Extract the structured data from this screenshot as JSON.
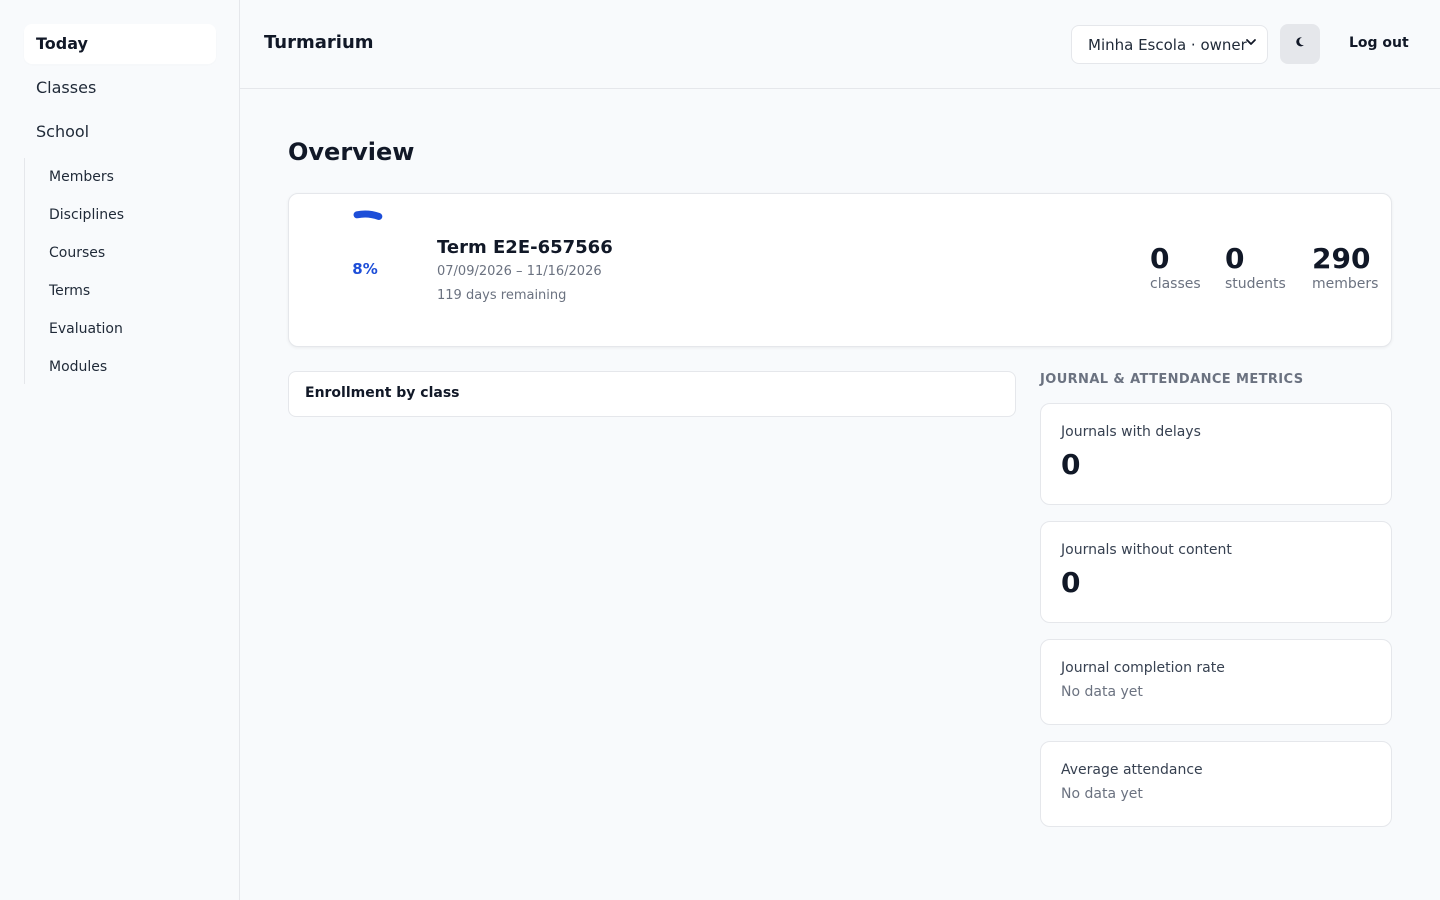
{
  "sidebar": {
    "items": [
      {
        "label": "Today"
      },
      {
        "label": "Classes"
      },
      {
        "label": "School"
      }
    ],
    "school_items": [
      {
        "label": "Members"
      },
      {
        "label": "Disciplines"
      },
      {
        "label": "Courses"
      },
      {
        "label": "Terms"
      },
      {
        "label": "Evaluation"
      },
      {
        "label": "Modules"
      }
    ]
  },
  "header": {
    "brand": "Turmarium",
    "school_select": "Minha Escola · owner",
    "theme_icon": "moon-icon",
    "logout_label": "Log out"
  },
  "main": {
    "title": "Overview",
    "term": {
      "progress_percent": 8,
      "progress_label": "8%",
      "name": "Term E2E-657566",
      "dates": "07/09/2026 – 11/16/2026",
      "remaining": "119 days remaining",
      "accent": "#1d4ed8"
    },
    "stats": [
      {
        "value": "0",
        "label": "classes"
      },
      {
        "value": "0",
        "label": "students"
      },
      {
        "value": "290",
        "label": "members"
      }
    ],
    "enrollment_title": "Enrollment by class",
    "metrics_heading": "JOURNAL & ATTENDANCE METRICS",
    "metrics": [
      {
        "label": "Journals with delays",
        "value": "0"
      },
      {
        "label": "Journals without content",
        "value": "0"
      },
      {
        "label": "Journal completion rate",
        "nodata": "No data yet"
      },
      {
        "label": "Average attendance",
        "nodata": "No data yet"
      }
    ]
  }
}
